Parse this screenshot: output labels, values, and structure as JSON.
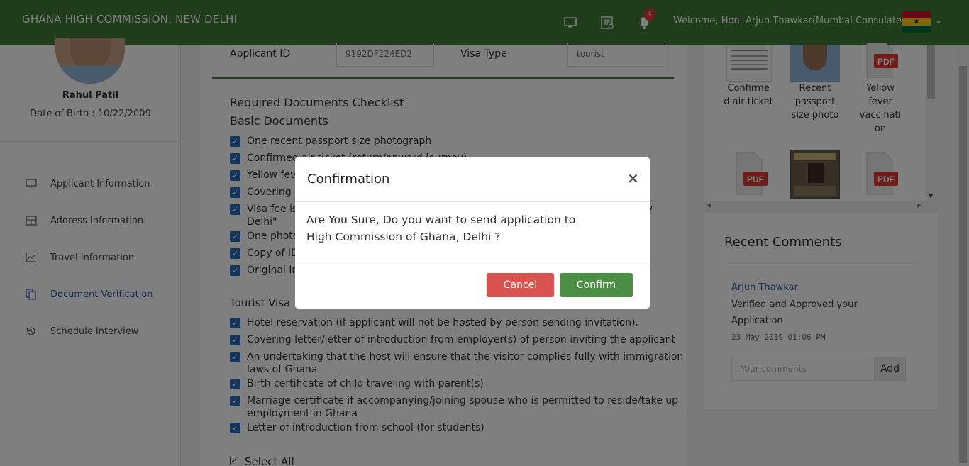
{
  "header": {
    "brand": "GHANA HIGH COMMISSION, NEW DELHI",
    "notification_count": "4",
    "welcome": "Welcome, Hon. Arjun Thawkar(Mumbai Consulates)",
    "flag_colors": [
      "#ce1126",
      "#fcd116",
      "#006b3f"
    ]
  },
  "sidebar": {
    "name": "Rahul Patil",
    "dob": "Date of Birth : 10/22/2009",
    "items": [
      {
        "label": "Applicant Information",
        "icon": "monitor-icon"
      },
      {
        "label": "Address Information",
        "icon": "table-icon"
      },
      {
        "label": "Travel Information",
        "icon": "chart-icon"
      },
      {
        "label": "Document Verification",
        "icon": "copy-icon"
      },
      {
        "label": "Schedule Interview",
        "icon": "history-icon"
      }
    ]
  },
  "main": {
    "applicant_id_label": "Applicant ID",
    "applicant_id_value": "9192DF224ED2",
    "visa_type_label": "Visa Type",
    "visa_type_value": "tourist",
    "checklist_title": "Required Documents Checklist",
    "basic_title": "Basic Documents",
    "basic_items": [
      "One recent passport size photograph",
      "Confirmed air ticket (return/onward journey)",
      "Yellow fever",
      "Covering le",
      "Visa fee is",
      "Delhi\"",
      "One photo",
      "Copy of ID",
      "Original Inv"
    ],
    "visa_fee_tail": "y",
    "tourist_title": "Tourist Visa",
    "tourist_items": [
      "Hotel reservation (if applicant will not be hosted by person sending invitation).",
      "Covering letter/letter of introduction from employer(s) of person inviting the applicant",
      "An undertaking that the host will ensure that the visitor complies fully with immigration",
      "laws of Ghana",
      "Birth certificate of child traveling with parent(s)",
      "Marriage certificate if accompanying/joining spouse who is permitted to reside/take up",
      "employment in Ghana",
      "Letter of introduction from school (for students)"
    ],
    "select_all": "Select All"
  },
  "documents": {
    "labels": [
      "Confirme",
      "d air ticket",
      "Recent",
      "passport",
      "size photo",
      "Yellow",
      "fever",
      "vaccinati",
      "on"
    ],
    "pdf": "PDF"
  },
  "comments": {
    "title": "Recent Comments",
    "author": "Arjun Thawkar",
    "text": "Verified and Approved your Application",
    "date": "23 May 2019 01:06 PM",
    "placeholder": "Your comments",
    "add": "Add"
  },
  "modal": {
    "title": "Confirmation",
    "close": "×",
    "line1": "Are You Sure, Do you want to send application to",
    "line2": "High Commission of Ghana, Delhi ?",
    "cancel": "Cancel",
    "confirm": "Confirm"
  }
}
